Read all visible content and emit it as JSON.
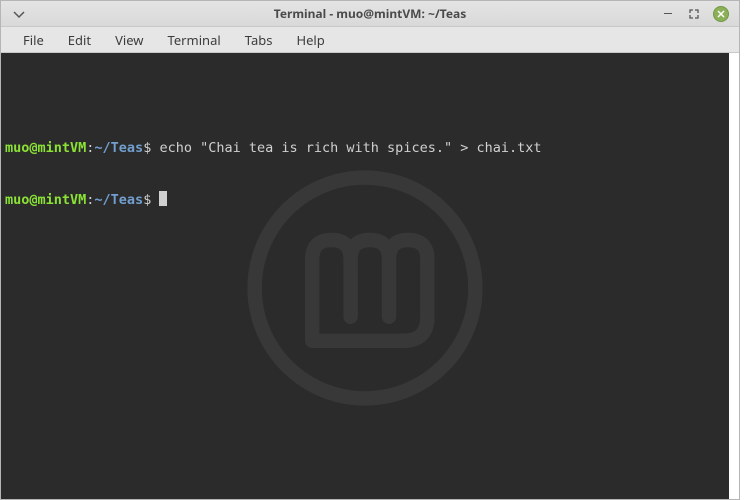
{
  "window": {
    "title": "Terminal - muo@mintVM: ~/Teas"
  },
  "menubar": {
    "items": [
      "File",
      "Edit",
      "View",
      "Terminal",
      "Tabs",
      "Help"
    ]
  },
  "terminal": {
    "lines": [
      {
        "user_host": "muo@mintVM",
        "sep": ":",
        "path": "~/Teas",
        "symbol": "$",
        "command": "echo \"Chai tea is rich with spices.\" > chai.txt"
      },
      {
        "user_host": "muo@mintVM",
        "sep": ":",
        "path": "~/Teas",
        "symbol": "$",
        "command": ""
      }
    ]
  }
}
